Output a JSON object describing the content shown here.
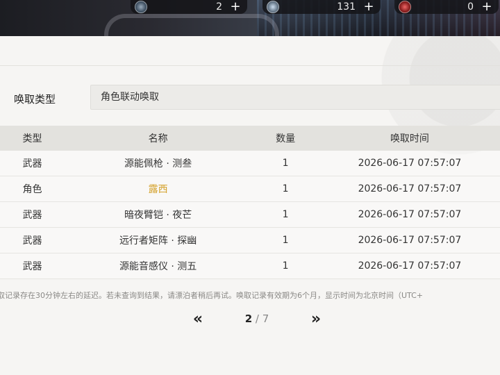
{
  "currencies": [
    {
      "icon": "token-icon",
      "amount": "2",
      "plus": "+"
    },
    {
      "icon": "star-crystal-icon",
      "amount": "131",
      "plus": "+"
    },
    {
      "icon": "red-gem-icon",
      "amount": "0",
      "plus": "+"
    }
  ],
  "filter": {
    "label": "唤取类型",
    "value": "角色联动唤取"
  },
  "table": {
    "headers": [
      "类型",
      "名称",
      "数量",
      "唤取时间"
    ],
    "rows": [
      {
        "type": "武器",
        "name": "源能佩枪 · 测叁",
        "qty": "1",
        "time": "2026-06-17 07:57:07"
      },
      {
        "type": "角色",
        "name": "露西",
        "qty": "1",
        "time": "2026-06-17 07:57:07"
      },
      {
        "type": "武器",
        "name": "暗夜臂铠 · 夜芒",
        "qty": "1",
        "time": "2026-06-17 07:57:07"
      },
      {
        "type": "武器",
        "name": "远行者矩阵 · 探幽",
        "qty": "1",
        "time": "2026-06-17 07:57:07"
      },
      {
        "type": "武器",
        "name": "源能音感仪 · 测五",
        "qty": "1",
        "time": "2026-06-17 07:57:07"
      }
    ]
  },
  "notice": "取记录存在30分钟左右的延迟。若未查询到结果，请漂泊者稍后再试。唤取记录有效期为6个月，显示时间为北京时间（UTC+",
  "pagination": {
    "prev": "«",
    "current": "2",
    "separator": " / ",
    "total": "7",
    "next": "»"
  },
  "colors": {
    "highlight_name": "#d4a12a",
    "card_bg": "#f6f5f3",
    "header_bg": "#e3e2de"
  }
}
